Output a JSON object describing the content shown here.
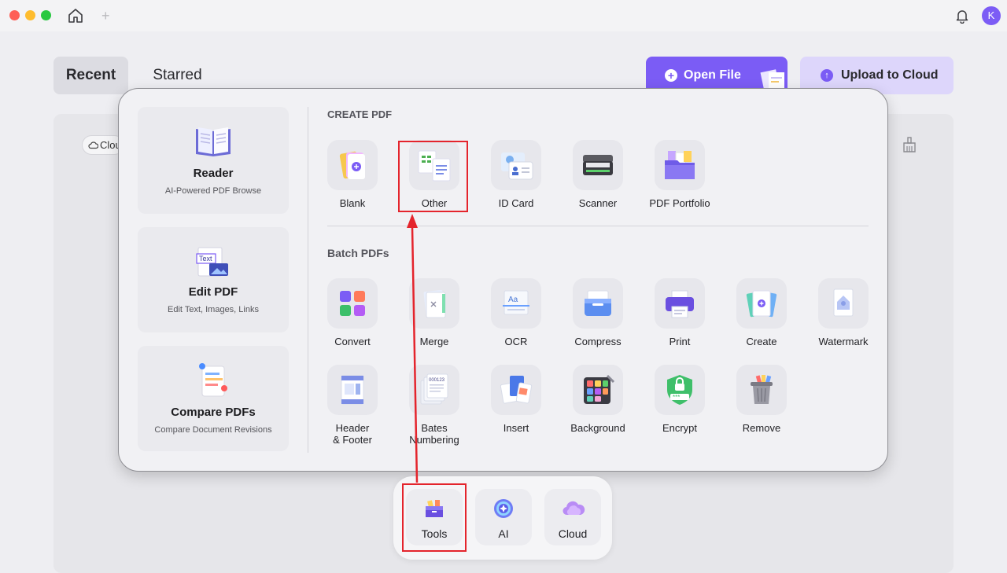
{
  "titlebar": {
    "avatar_initial": "K"
  },
  "tabs": {
    "recent": "Recent",
    "starred": "Starred"
  },
  "actions": {
    "open_file": "Open File",
    "upload_cloud": "Upload to Cloud"
  },
  "filter": {
    "cloud_chip": "Clou"
  },
  "sidebar": [
    {
      "title": "Reader",
      "subtitle": "AI-Powered PDF Browse",
      "icon": "book-icon"
    },
    {
      "title": "Edit PDF",
      "subtitle": "Edit Text, Images, Links",
      "icon": "edit-text-icon"
    },
    {
      "title": "Compare PDFs",
      "subtitle": "Compare Document Revisions",
      "icon": "compare-icon"
    }
  ],
  "create_pdf": {
    "title": "CREATE PDF",
    "items": [
      {
        "label": "Blank",
        "icon": "blank-pdf-icon"
      },
      {
        "label": "Other",
        "icon": "other-formats-icon"
      },
      {
        "label": "ID Card",
        "icon": "id-card-icon"
      },
      {
        "label": "Scanner",
        "icon": "scanner-icon"
      },
      {
        "label": "PDF Portfolio",
        "icon": "portfolio-icon"
      }
    ]
  },
  "batch": {
    "title": "Batch PDFs",
    "row1": [
      {
        "label": "Convert",
        "icon": "convert-icon"
      },
      {
        "label": "Merge",
        "icon": "merge-icon"
      },
      {
        "label": "OCR",
        "icon": "ocr-icon"
      },
      {
        "label": "Compress",
        "icon": "compress-icon"
      },
      {
        "label": "Print",
        "icon": "print-icon"
      },
      {
        "label": "Create",
        "icon": "create-icon"
      },
      {
        "label": "Watermark",
        "icon": "watermark-icon"
      }
    ],
    "row2": [
      {
        "label1": "Header",
        "label2": "& Footer",
        "icon": "header-footer-icon"
      },
      {
        "label1": "Bates",
        "label2": "Numbering",
        "icon": "bates-icon"
      },
      {
        "label1": "Insert",
        "label2": "",
        "icon": "insert-icon"
      },
      {
        "label1": "Background",
        "label2": "",
        "icon": "background-icon"
      },
      {
        "label1": "Encrypt",
        "label2": "",
        "icon": "encrypt-icon"
      },
      {
        "label1": "Remove",
        "label2": "",
        "icon": "remove-icon"
      }
    ]
  },
  "dock": [
    {
      "label": "Tools",
      "icon": "tools-icon"
    },
    {
      "label": "AI",
      "icon": "ai-icon"
    },
    {
      "label": "Cloud",
      "icon": "cloud-icon"
    }
  ],
  "colors": {
    "accent": "#7b5cf5",
    "highlight": "#e4242c"
  }
}
